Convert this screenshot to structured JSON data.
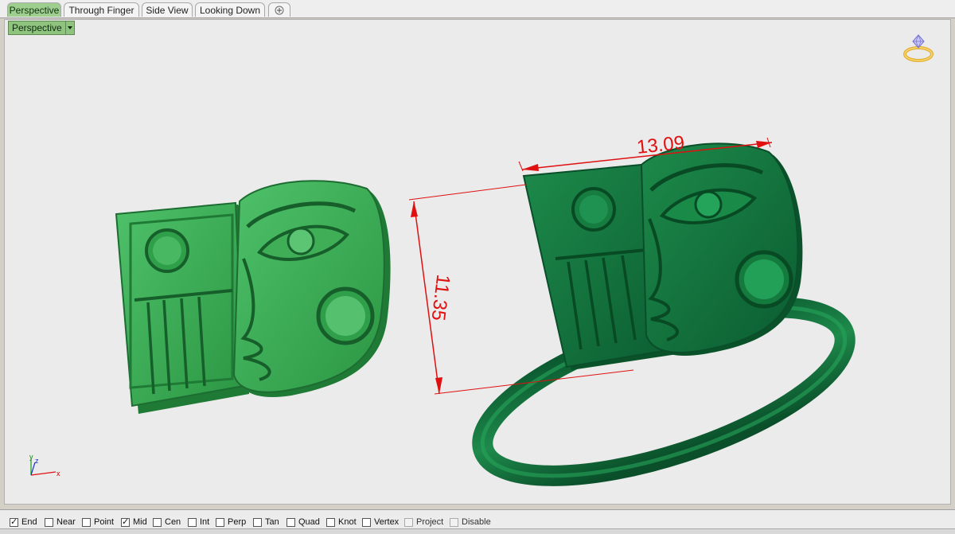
{
  "tabs": [
    "Perspective",
    "Through Finger",
    "Side View",
    "Looking Down"
  ],
  "add_tab_icon": "plus-icon",
  "viewport": {
    "label": "Perspective",
    "menu_icon": "triangle-down-icon",
    "logo_icon": "ring-diamond-logo-icon",
    "dimensions": {
      "width": "13.09",
      "height": "11.35"
    },
    "axis": {
      "x": "x",
      "y": "y",
      "z": "z"
    }
  },
  "osnaps": [
    {
      "label": "End",
      "checked": true
    },
    {
      "label": "Near",
      "checked": false
    },
    {
      "label": "Point",
      "checked": false
    },
    {
      "label": "Mid",
      "checked": true
    },
    {
      "label": "Cen",
      "checked": false
    },
    {
      "label": "Int",
      "checked": false
    },
    {
      "label": "Perp",
      "checked": false
    },
    {
      "label": "Tan",
      "checked": false
    },
    {
      "label": "Quad",
      "checked": false
    },
    {
      "label": "Knot",
      "checked": false
    },
    {
      "label": "Vertex",
      "checked": false
    },
    {
      "label": "Project",
      "checked": false
    },
    {
      "label": "Disable",
      "checked": false
    }
  ],
  "colors": {
    "model_green": "#2f9f4a",
    "model_dark": "#0f6a3a",
    "dim_red": "#e01010",
    "tab_active": "#9fcf8f"
  }
}
